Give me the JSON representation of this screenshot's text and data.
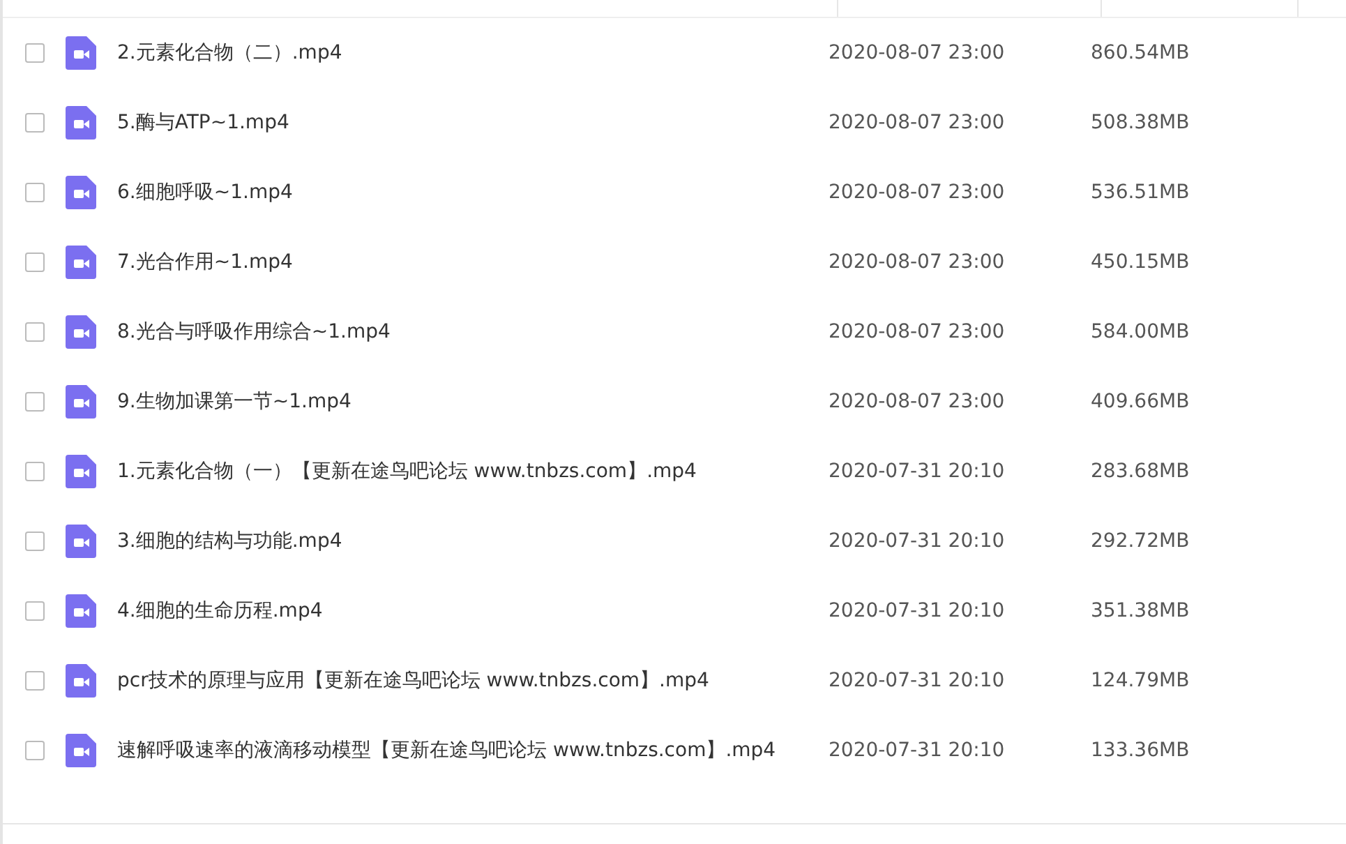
{
  "files": [
    {
      "name": "2.元素化合物（二）.mp4",
      "modified": "2020-08-07 23:00",
      "size": "860.54MB",
      "checked": false
    },
    {
      "name": "5.酶与ATP~1.mp4",
      "modified": "2020-08-07 23:00",
      "size": "508.38MB",
      "checked": false
    },
    {
      "name": "6.细胞呼吸~1.mp4",
      "modified": "2020-08-07 23:00",
      "size": "536.51MB",
      "checked": false
    },
    {
      "name": "7.光合作用~1.mp4",
      "modified": "2020-08-07 23:00",
      "size": "450.15MB",
      "checked": false
    },
    {
      "name": "8.光合与呼吸作用综合~1.mp4",
      "modified": "2020-08-07 23:00",
      "size": "584.00MB",
      "checked": false
    },
    {
      "name": "9.生物加课第一节~1.mp4",
      "modified": "2020-08-07 23:00",
      "size": "409.66MB",
      "checked": false
    },
    {
      "name": "1.元素化合物（一）【更新在途鸟吧论坛 www.tnbzs.com】.mp4",
      "modified": "2020-07-31 20:10",
      "size": "283.68MB",
      "checked": false
    },
    {
      "name": "3.细胞的结构与功能.mp4",
      "modified": "2020-07-31 20:10",
      "size": "292.72MB",
      "checked": false
    },
    {
      "name": "4.细胞的生命历程.mp4",
      "modified": "2020-07-31 20:10",
      "size": "351.38MB",
      "checked": false
    },
    {
      "name": "pcr技术的原理与应用【更新在途鸟吧论坛 www.tnbzs.com】.mp4",
      "modified": "2020-07-31 20:10",
      "size": "124.79MB",
      "checked": false
    },
    {
      "name": "速解呼吸速率的液滴移动模型【更新在途鸟吧论坛 www.tnbzs.com】.mp4",
      "modified": "2020-07-31 20:10",
      "size": "133.36MB",
      "checked": false
    }
  ]
}
